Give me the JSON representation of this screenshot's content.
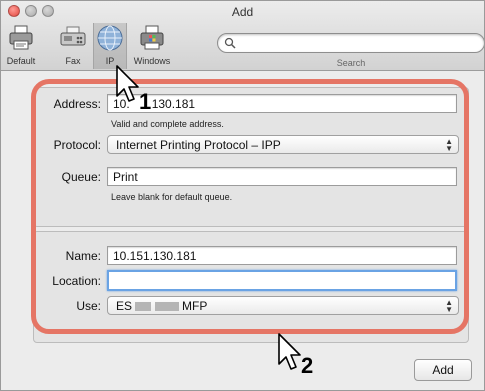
{
  "window": {
    "title": "Add"
  },
  "toolbar": {
    "items": [
      {
        "label": "Default",
        "icon": "default-printer-icon"
      },
      {
        "label": "Fax",
        "icon": "fax-icon"
      },
      {
        "label": "IP",
        "icon": "ip-globe-icon",
        "selected": true
      },
      {
        "label": "Windows",
        "icon": "windows-printer-icon"
      }
    ],
    "search_label": "Search",
    "search_value": ""
  },
  "form": {
    "address_label": "Address:",
    "address_value": "10.",
    "address_value_tail": "130.181",
    "address_hint": "Valid and complete address.",
    "protocol_label": "Protocol:",
    "protocol_value": "Internet Printing Protocol – IPP",
    "queue_label": "Queue:",
    "queue_value": "Print",
    "queue_hint": "Leave blank for default queue.",
    "name_label": "Name:",
    "name_value": "10.151.130.181",
    "location_label": "Location:",
    "location_value": "",
    "use_label": "Use:",
    "use_value_prefix": "ES",
    "use_value_suffix": "MFP"
  },
  "annotations": {
    "step1": "1",
    "step2": "2",
    "highlight_color": "#e57565"
  },
  "buttons": {
    "add_label": "Add"
  }
}
